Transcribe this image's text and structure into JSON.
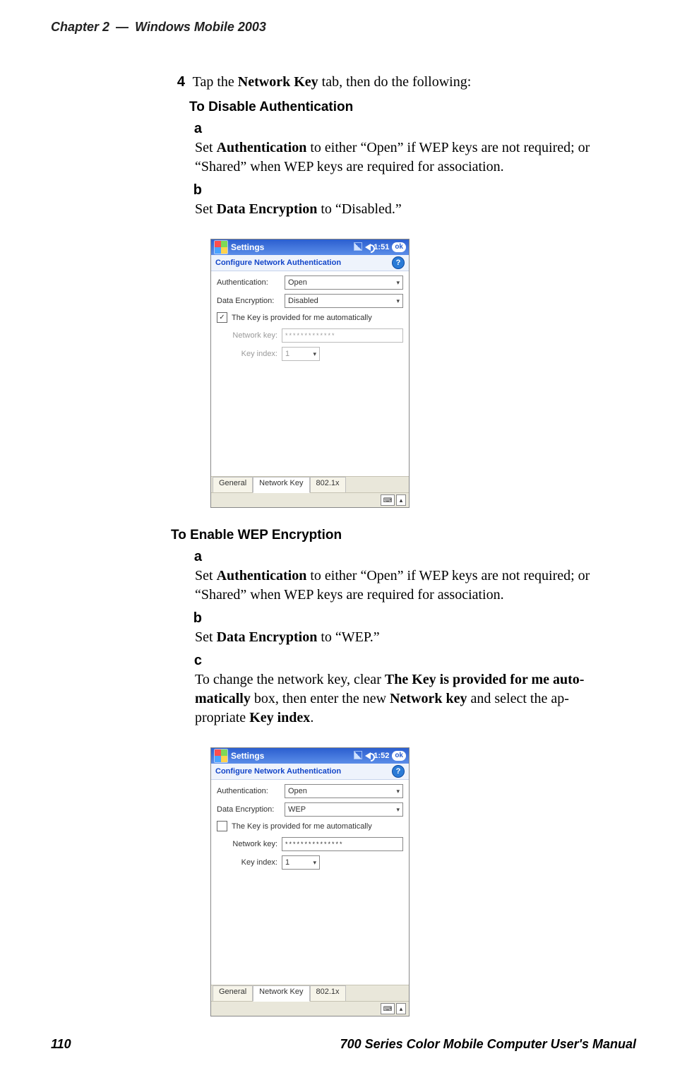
{
  "header": {
    "chapter": "Chapter 2",
    "dash": "—",
    "title": "Windows Mobile 2003"
  },
  "footer": {
    "page_number": "110",
    "manual_title": "700 Series Color Mobile Computer User's Manual"
  },
  "step4": {
    "num": "4",
    "before_bold": "Tap the ",
    "bold1": "Network Key",
    "after_bold": " tab, then do the following:"
  },
  "disable": {
    "heading": "To Disable Authentication",
    "a": {
      "letter": "a",
      "p1": "Set ",
      "b1": "Authentication",
      "p2": " to either “Open” if WEP keys are not required; or “Shared” when WEP keys are required for association."
    },
    "b": {
      "letter": "b",
      "p1": "Set ",
      "b1": "Data Encryption",
      "p2": " to “Disabled.”"
    }
  },
  "enable": {
    "heading": "To Enable WEP Encryption",
    "a": {
      "letter": "a",
      "p1": "Set ",
      "b1": "Authentication",
      "p2": " to either “Open” if WEP keys are not required; or “Shared” when WEP keys are required for association."
    },
    "b": {
      "letter": "b",
      "p1": "Set ",
      "b1": "Data Encryption",
      "p2": " to “WEP.”"
    },
    "c": {
      "letter": "c",
      "p1": "To change the network key, clear ",
      "b1": "The Key is provided for me auto-",
      "b1b": "matically",
      "p2": " box, then enter the new ",
      "b2": "Network key",
      "p3": " and select the ap-",
      "p3b": "propriate ",
      "b3": "Key index",
      "p4": "."
    }
  },
  "shot_common": {
    "titlebar": "Settings",
    "subtitle": "Configure Network Authentication",
    "help": "?",
    "ok": "ok",
    "lbl_auth": "Authentication:",
    "lbl_enc": "Data Encryption:",
    "auth_value": "Open",
    "auto_key": "The Key is provided for me automatically",
    "lbl_netkey": "Network key:",
    "lbl_keyidx": "Key index:",
    "idx_value": "1",
    "tab_general": "General",
    "tab_netkey": "Network Key",
    "tab_8021x": "802.1x",
    "kb": "⌨",
    "caret_up": "▴",
    "caret_down": "▾"
  },
  "shot1": {
    "clock": "1:51",
    "enc_value": "Disabled",
    "pw": "*************",
    "check": "✓",
    "auto_checked": true
  },
  "shot2": {
    "clock": "1:52",
    "enc_value": "WEP",
    "pw": "***************",
    "check": "",
    "auto_checked": false
  }
}
